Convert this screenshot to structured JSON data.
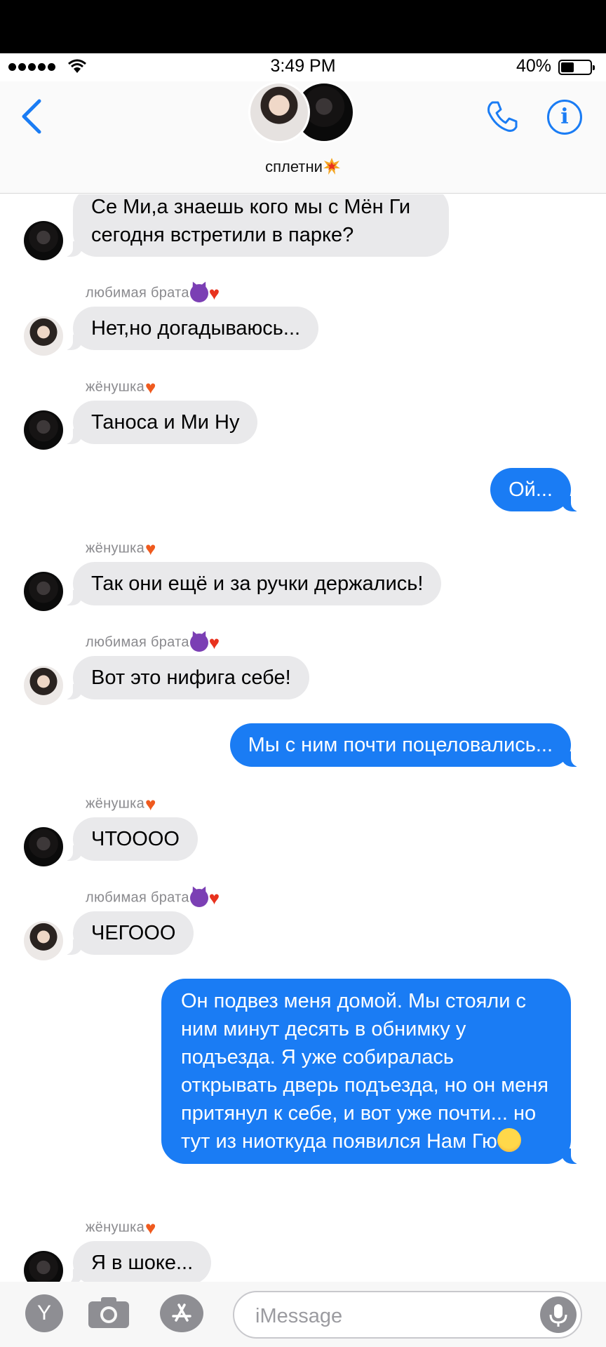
{
  "status": {
    "time": "3:49 PM",
    "battery": "40%",
    "battery_level": 0.4
  },
  "header": {
    "group_name": "сплетни",
    "group_icon": "explosion-icon",
    "back_icon": "chevron-left-icon",
    "call_icon": "phone-icon",
    "info_icon": "info-icon",
    "accent_color": "#1a7cf4"
  },
  "messages": [
    {
      "dir": "in",
      "avatar": "dark",
      "text": "Се Ми,а знаешь кого мы с Мён Ги сегодня встретили в парке?"
    },
    {
      "dir": "in",
      "sender": "любимая брата",
      "sender_emojis": [
        "devil-icon",
        "red-heart-icon"
      ],
      "avatar": "light",
      "text": "Нет,но догадываюсь..."
    },
    {
      "dir": "in",
      "sender": "жёнушка",
      "sender_emojis": [
        "heart-on-fire-icon"
      ],
      "avatar": "dark",
      "text": "Таноса и Ми Ну"
    },
    {
      "dir": "out",
      "text": "Ой..."
    },
    {
      "dir": "in",
      "sender": "жёнушка",
      "sender_emojis": [
        "heart-on-fire-icon"
      ],
      "avatar": "dark",
      "text": "Так они ещё и за ручки держались!"
    },
    {
      "dir": "in",
      "sender": "любимая брата",
      "sender_emojis": [
        "devil-icon",
        "red-heart-icon"
      ],
      "avatar": "light",
      "text": "Вот это нифига себе!"
    },
    {
      "dir": "out",
      "text": "Мы с ним почти поцеловались..."
    },
    {
      "dir": "in",
      "sender": "жёнушка",
      "sender_emojis": [
        "heart-on-fire-icon"
      ],
      "avatar": "dark",
      "text": "ЧТОООО"
    },
    {
      "dir": "in",
      "sender": "любимая брата",
      "sender_emojis": [
        "devil-icon",
        "red-heart-icon"
      ],
      "avatar": "light",
      "text": "ЧЕГООО"
    },
    {
      "dir": "out",
      "text": "Он подвез меня домой. Мы стояли с ним минут десять в обнимку у подъезда. Я уже собиралась открывать дверь подъезда, но он меня притянул к себе, и вот уже почти... но тут из ниоткуда появился Нам Гю",
      "trailing_emoji": "angry-face-icon"
    },
    {
      "dir": "in",
      "sender": "жёнушка",
      "sender_emojis": [
        "heart-on-fire-icon"
      ],
      "avatar": "dark",
      "text": "Я в шоке..."
    }
  ],
  "composer": {
    "placeholder": "iMessage",
    "left_button_label": "Y",
    "camera_icon": "camera-icon",
    "appstore_icon": "app-store-icon",
    "mic_icon": "microphone-icon"
  }
}
